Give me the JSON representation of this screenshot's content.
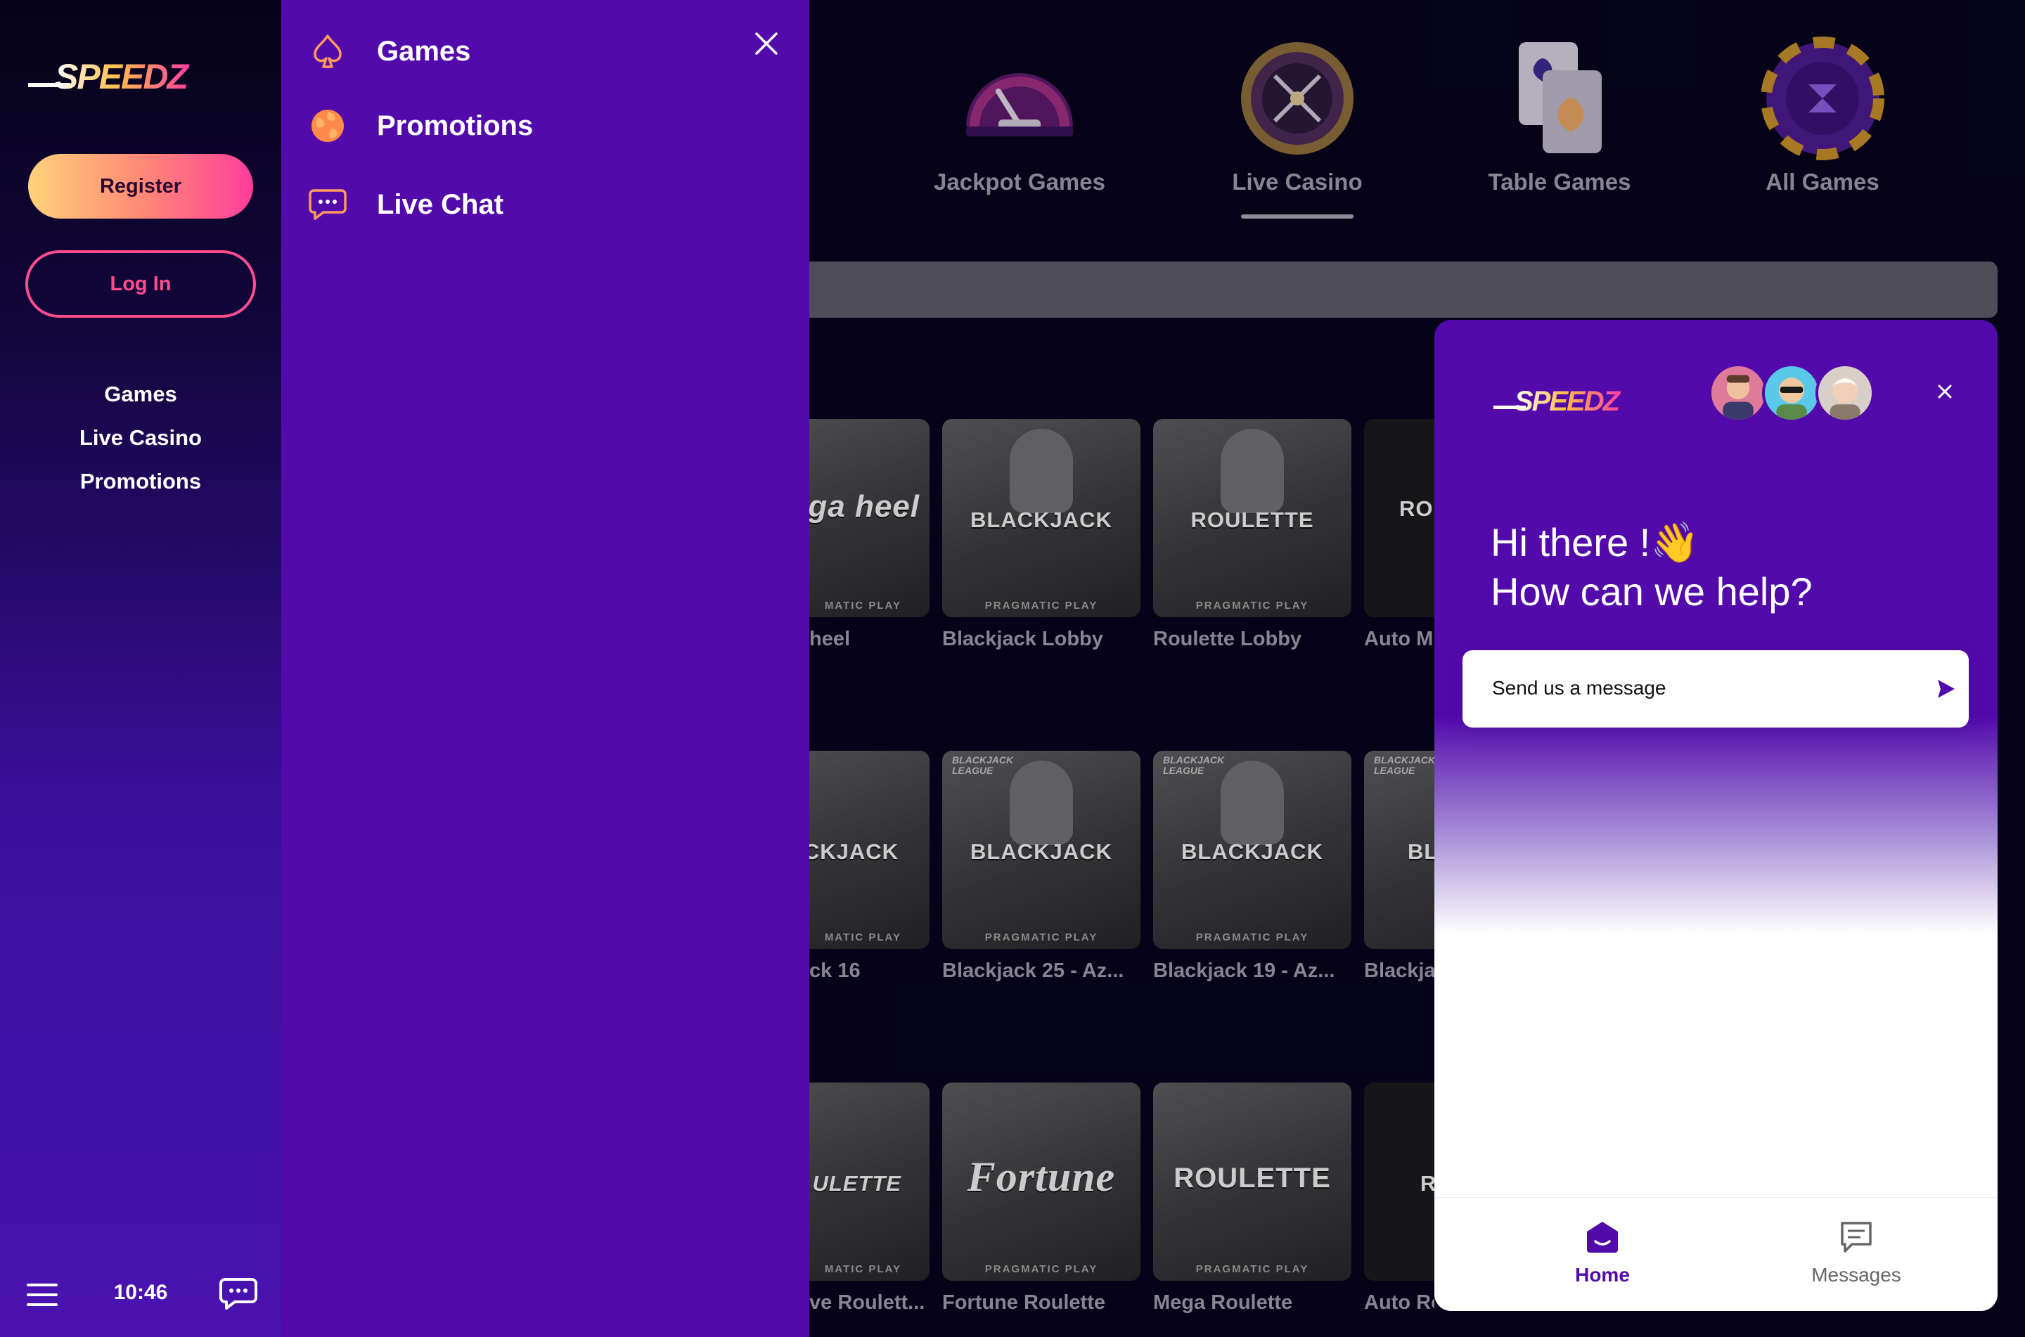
{
  "brand": {
    "name": "SPEEDZ"
  },
  "sidebar": {
    "register_label": "Register",
    "login_label": "Log In",
    "nav": [
      "Games",
      "Live Casino",
      "Promotions"
    ],
    "time": "10:46"
  },
  "menu": {
    "items": [
      {
        "label": "Games",
        "icon": "spade-icon"
      },
      {
        "label": "Promotions",
        "icon": "globe-icon"
      },
      {
        "label": "Live Chat",
        "icon": "chat-icon"
      }
    ]
  },
  "categories": [
    {
      "label": "Jackpot Games",
      "icon": "speedometer-icon"
    },
    {
      "label": "Live Casino",
      "icon": "roulette-icon",
      "active": true
    },
    {
      "label": "Table Games",
      "icon": "cards-icon"
    },
    {
      "label": "All Games",
      "icon": "chip-icon"
    }
  ],
  "games": {
    "row1": [
      {
        "tile": "ega\nheel",
        "name": "heel"
      },
      {
        "tile": "BLACKJACK",
        "name": "Blackjack Lobby",
        "provider": "PRAGMATIC PLAY"
      },
      {
        "tile": "ROULETTE",
        "name": "Roulette Lobby",
        "provider": "PRAGMATIC PLAY"
      },
      {
        "tile": "RO",
        "name": "Auto M"
      }
    ],
    "row2": [
      {
        "tile": "CKJACK",
        "name": "ck 16"
      },
      {
        "tile": "BLACKJACK",
        "name": "Blackjack 25 - Az...",
        "provider": "PRAGMATIC PLAY",
        "league": "BLACKJACK\nLEAGUE"
      },
      {
        "tile": "BLACKJACK",
        "name": "Blackjack 19 - Az...",
        "provider": "PRAGMATIC PLAY",
        "league": "BLACKJACK\nLEAGUE"
      },
      {
        "tile": "BL",
        "name": "Blackja",
        "league": "BLACKJACK\nLEAGUE"
      }
    ],
    "row3": [
      {
        "tile": "ULETTE",
        "name": "ve Roulett..."
      },
      {
        "tile": "Fortune",
        "name": "Fortune Roulette",
        "provider": "PRAGMATIC PLAY"
      },
      {
        "tile": "ROULETTE",
        "name": "Mega Roulette",
        "provider": "PRAGMATIC PLAY"
      },
      {
        "tile": "R",
        "name": "Auto Ro"
      }
    ],
    "provider_partial": "MATIC PLAY"
  },
  "chat": {
    "greeting_line1": "Hi there !👋",
    "greeting_line2": "How can we help?",
    "message_placeholder": "Send us a message",
    "tabs": [
      {
        "label": "Home",
        "active": true
      },
      {
        "label": "Messages",
        "active": false
      }
    ],
    "colors": {
      "brand_purple": "#520aab",
      "active_tab": "#520aab",
      "inactive_tab": "#666666"
    }
  }
}
